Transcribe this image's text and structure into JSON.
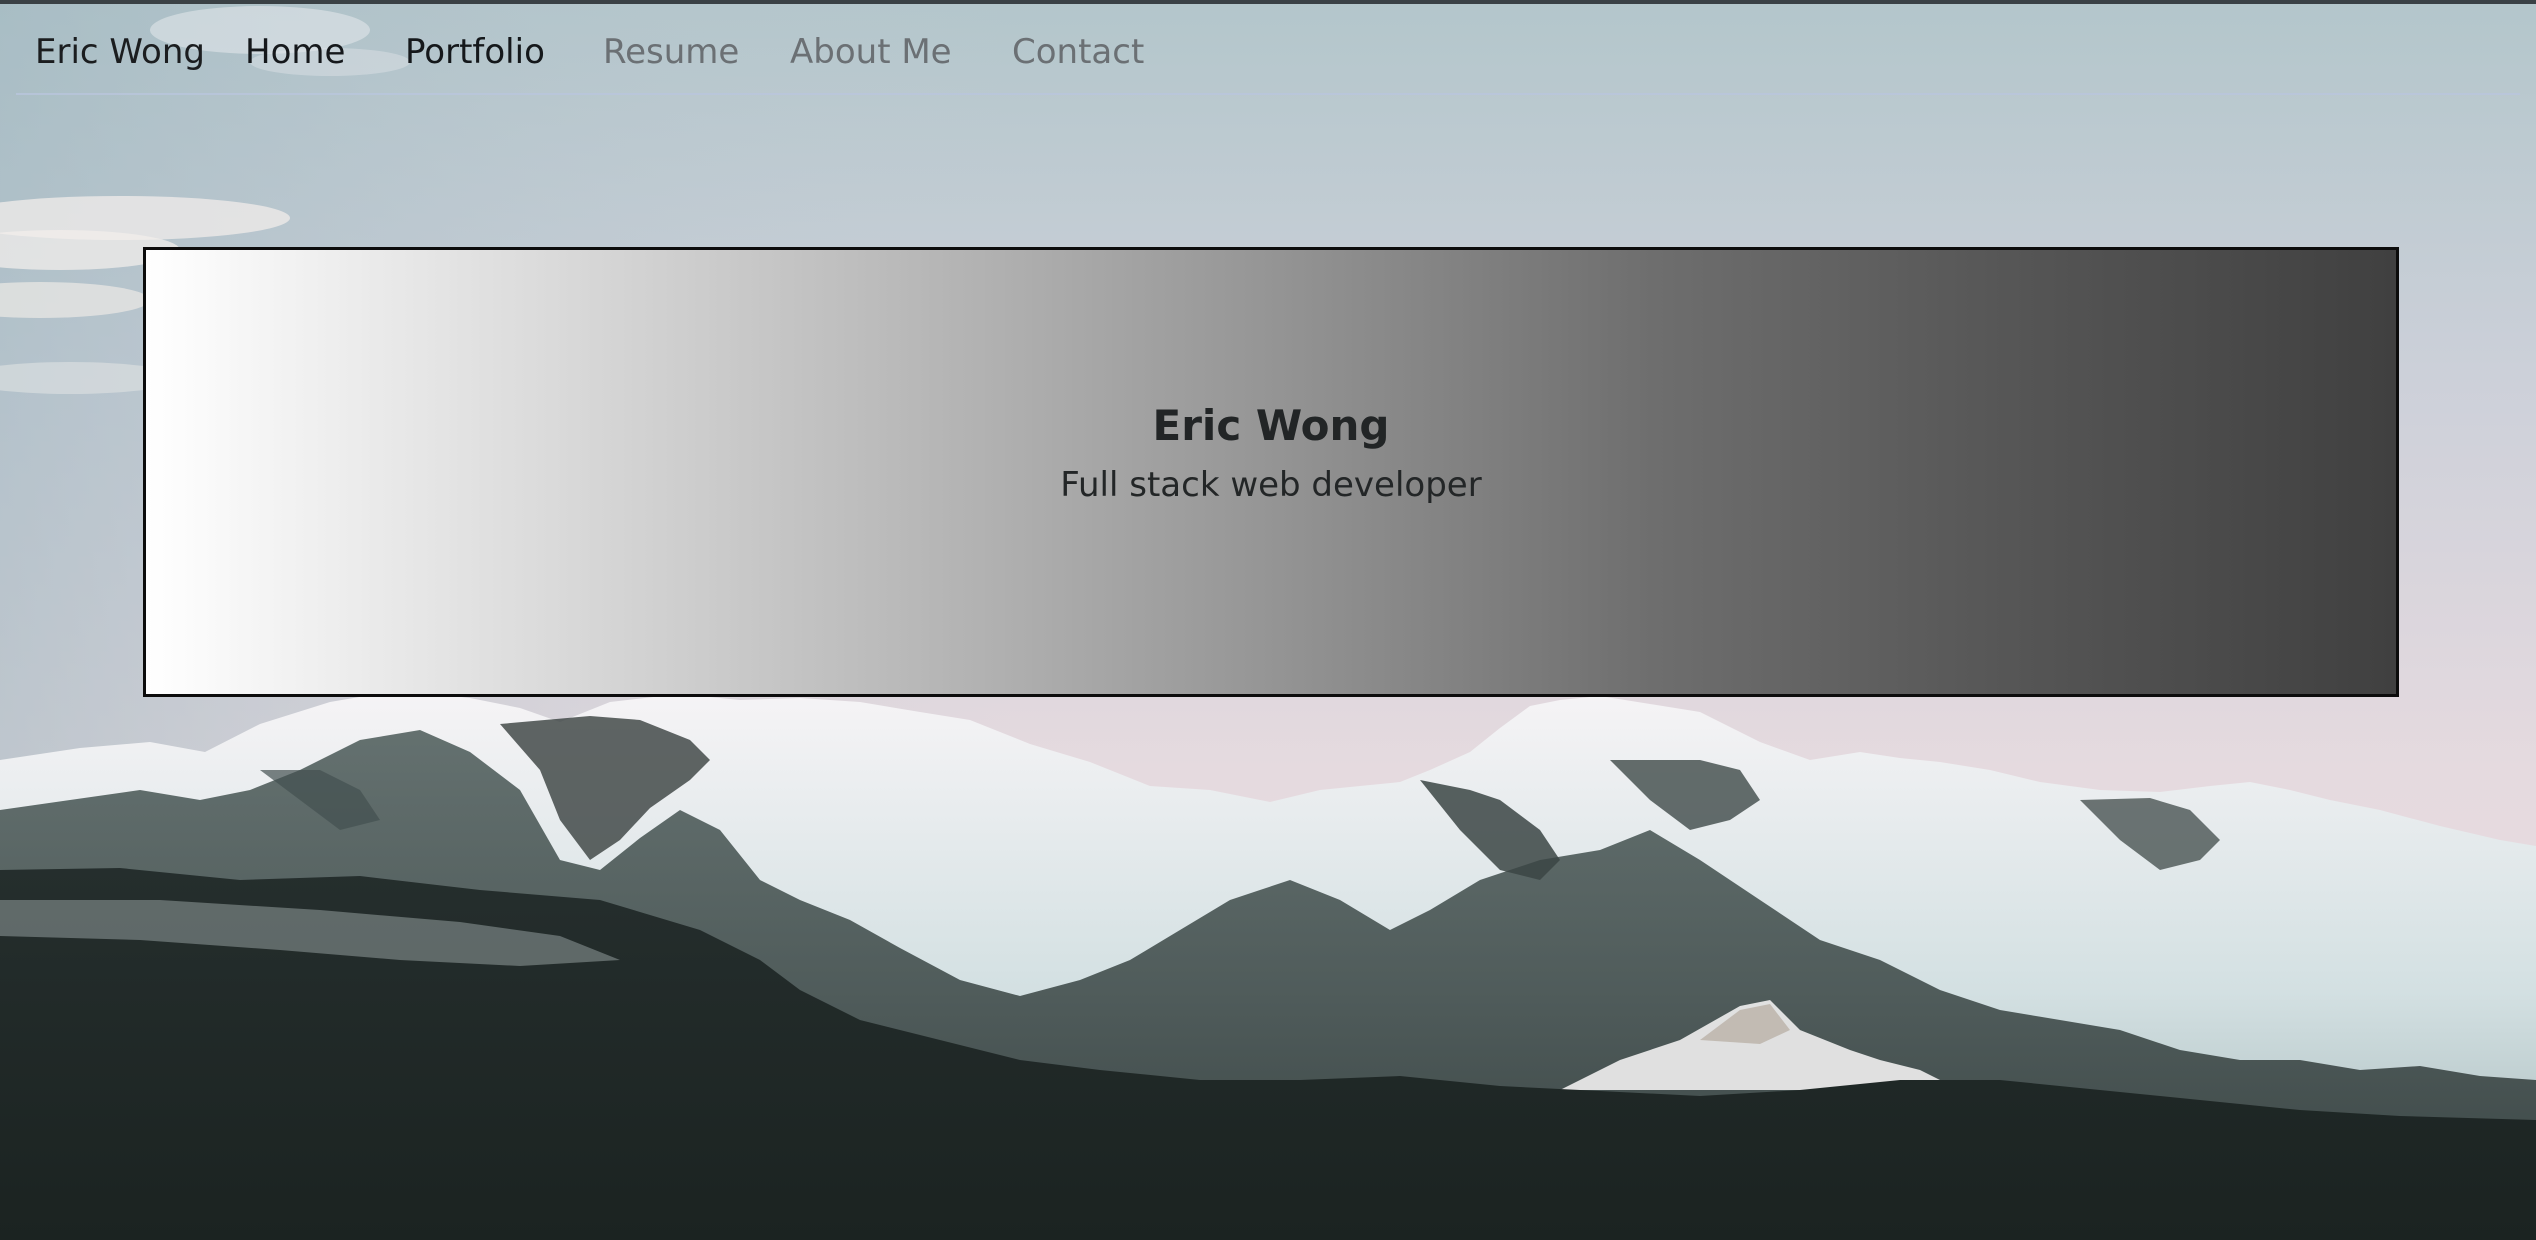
{
  "nav": {
    "brand": "Eric Wong",
    "links": [
      {
        "label": "Home",
        "state": "active"
      },
      {
        "label": "Portfolio",
        "state": "active"
      },
      {
        "label": "Resume",
        "state": "muted"
      },
      {
        "label": "About Me",
        "state": "muted"
      },
      {
        "label": "Contact",
        "state": "muted"
      }
    ]
  },
  "hero": {
    "title": "Eric Wong",
    "subtitle": "Full stack web developer"
  },
  "colors": {
    "nav_text": "#15181b",
    "nav_muted": "#6b7074",
    "hero_border": "#0c0c0c",
    "gradient_start": "#ffffff",
    "gradient_end": "#404040",
    "sky_top": "#b5c6cd",
    "sky_bottom": "#e8d8dd",
    "mountain_shadow": "#1d2523"
  },
  "background": {
    "subject": "snow-capped-mountain-range-icon"
  }
}
